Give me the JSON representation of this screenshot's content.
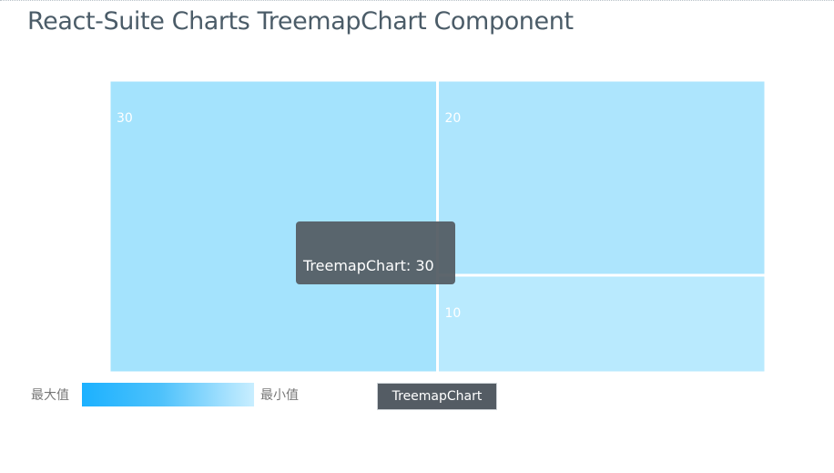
{
  "page": {
    "title": "React-Suite Charts TreemapChart Component"
  },
  "chart_data": {
    "type": "treemap",
    "series": [
      {
        "name": "TreemapChart",
        "nodes": [
          {
            "label": "30",
            "value": 30
          },
          {
            "label": "20",
            "value": 20
          },
          {
            "label": "10",
            "value": 10
          }
        ]
      }
    ],
    "legend": [
      "TreemapChart"
    ],
    "tooltip": "TreemapChart: 30",
    "visual_map": {
      "max_label": "最大值",
      "min_label": "最小值",
      "colors": [
        "#1cb1ff",
        "#c9eeff"
      ]
    },
    "colors": {
      "node_30": "#a4e3fd",
      "node_20": "#ade5fd",
      "node_10": "#b9eafe",
      "node_label": "#ffffff",
      "tooltip_bg": "#545c64",
      "legend_bg": "#545c64"
    }
  }
}
